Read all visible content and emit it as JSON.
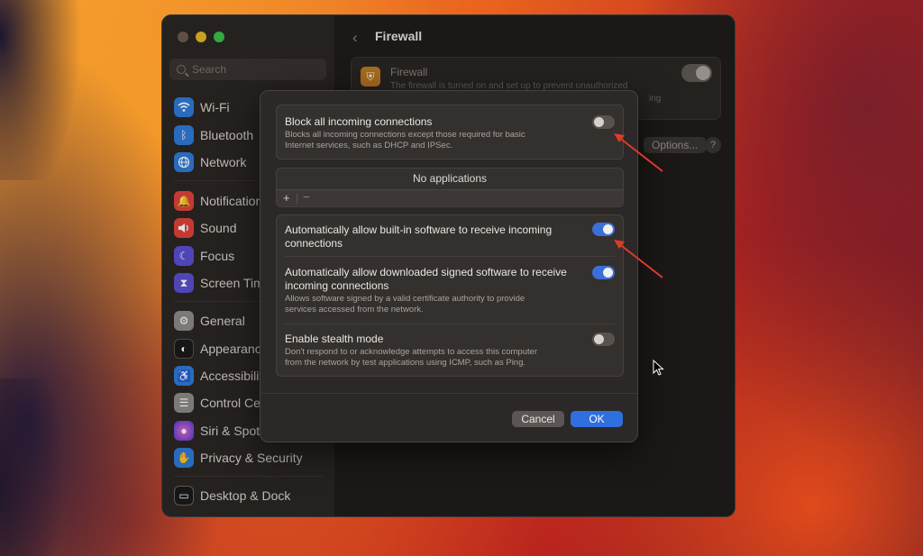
{
  "sidebar": {
    "search_placeholder": "Search",
    "items": [
      {
        "label": "Wi-Fi",
        "icon": "wifi-icon",
        "color": "#2f7ad8"
      },
      {
        "label": "Bluetooth",
        "icon": "bluetooth-icon",
        "color": "#2f7ad8"
      },
      {
        "label": "Network",
        "icon": "globe-icon",
        "color": "#2f7ad8"
      },
      {
        "label": "Notifications",
        "icon": "bell-icon",
        "color": "#e0433b"
      },
      {
        "label": "Sound",
        "icon": "speaker-icon",
        "color": "#e0433b"
      },
      {
        "label": "Focus",
        "icon": "moon-icon",
        "color": "#5c4fd0"
      },
      {
        "label": "Screen Time",
        "icon": "hourglass-icon",
        "color": "#5c4fd0"
      },
      {
        "label": "General",
        "icon": "gear-icon",
        "color": "#8e8a87"
      },
      {
        "label": "Appearance",
        "icon": "appearance-icon",
        "color": "#1a1a1a"
      },
      {
        "label": "Accessibility",
        "icon": "accessibility-icon",
        "color": "#2f7ad8"
      },
      {
        "label": "Control Centre",
        "icon": "control-centre-icon",
        "color": "#8e8a87"
      },
      {
        "label": "Siri & Spotlight",
        "icon": "siri-icon",
        "color": "#c74fd0"
      },
      {
        "label": "Privacy & Security",
        "icon": "hand-icon",
        "color": "#2f7ad8"
      },
      {
        "label": "Desktop & Dock",
        "icon": "dock-icon",
        "color": "#1a1a1a"
      }
    ]
  },
  "content": {
    "title": "Firewall",
    "card_title": "Firewall",
    "card_desc": "The firewall is turned on and set up to prevent unauthorized",
    "card_desc_tail": "ing",
    "options_label": "Options...",
    "help_label": "?"
  },
  "sheet": {
    "block": {
      "title": "Block all incoming connections",
      "desc_line1": "Blocks all incoming connections except those required for basic",
      "desc_line2": "Internet services, such as DHCP and IPSec.",
      "on": false
    },
    "apps_empty": "No applications",
    "apps_add": "+",
    "apps_remove": "−",
    "builtin": {
      "title_line1": "Automatically allow built-in software to receive incoming",
      "title_line2": "connections",
      "on": true
    },
    "signed": {
      "title_line1": "Automatically allow downloaded signed software to receive",
      "title_line2": "incoming connections",
      "desc_line1": "Allows software signed by a valid certificate authority to provide",
      "desc_line2": "services accessed from the network.",
      "on": true
    },
    "stealth": {
      "title": "Enable stealth mode",
      "desc_line1": "Don't respond to or acknowledge attempts to access this computer",
      "desc_line2": "from the network by test applications using ICMP, such as Ping.",
      "on": false
    },
    "cancel_label": "Cancel",
    "ok_label": "OK"
  },
  "colors": {
    "accent": "#2f6fde",
    "annotation_arrow": "#e0392b"
  }
}
